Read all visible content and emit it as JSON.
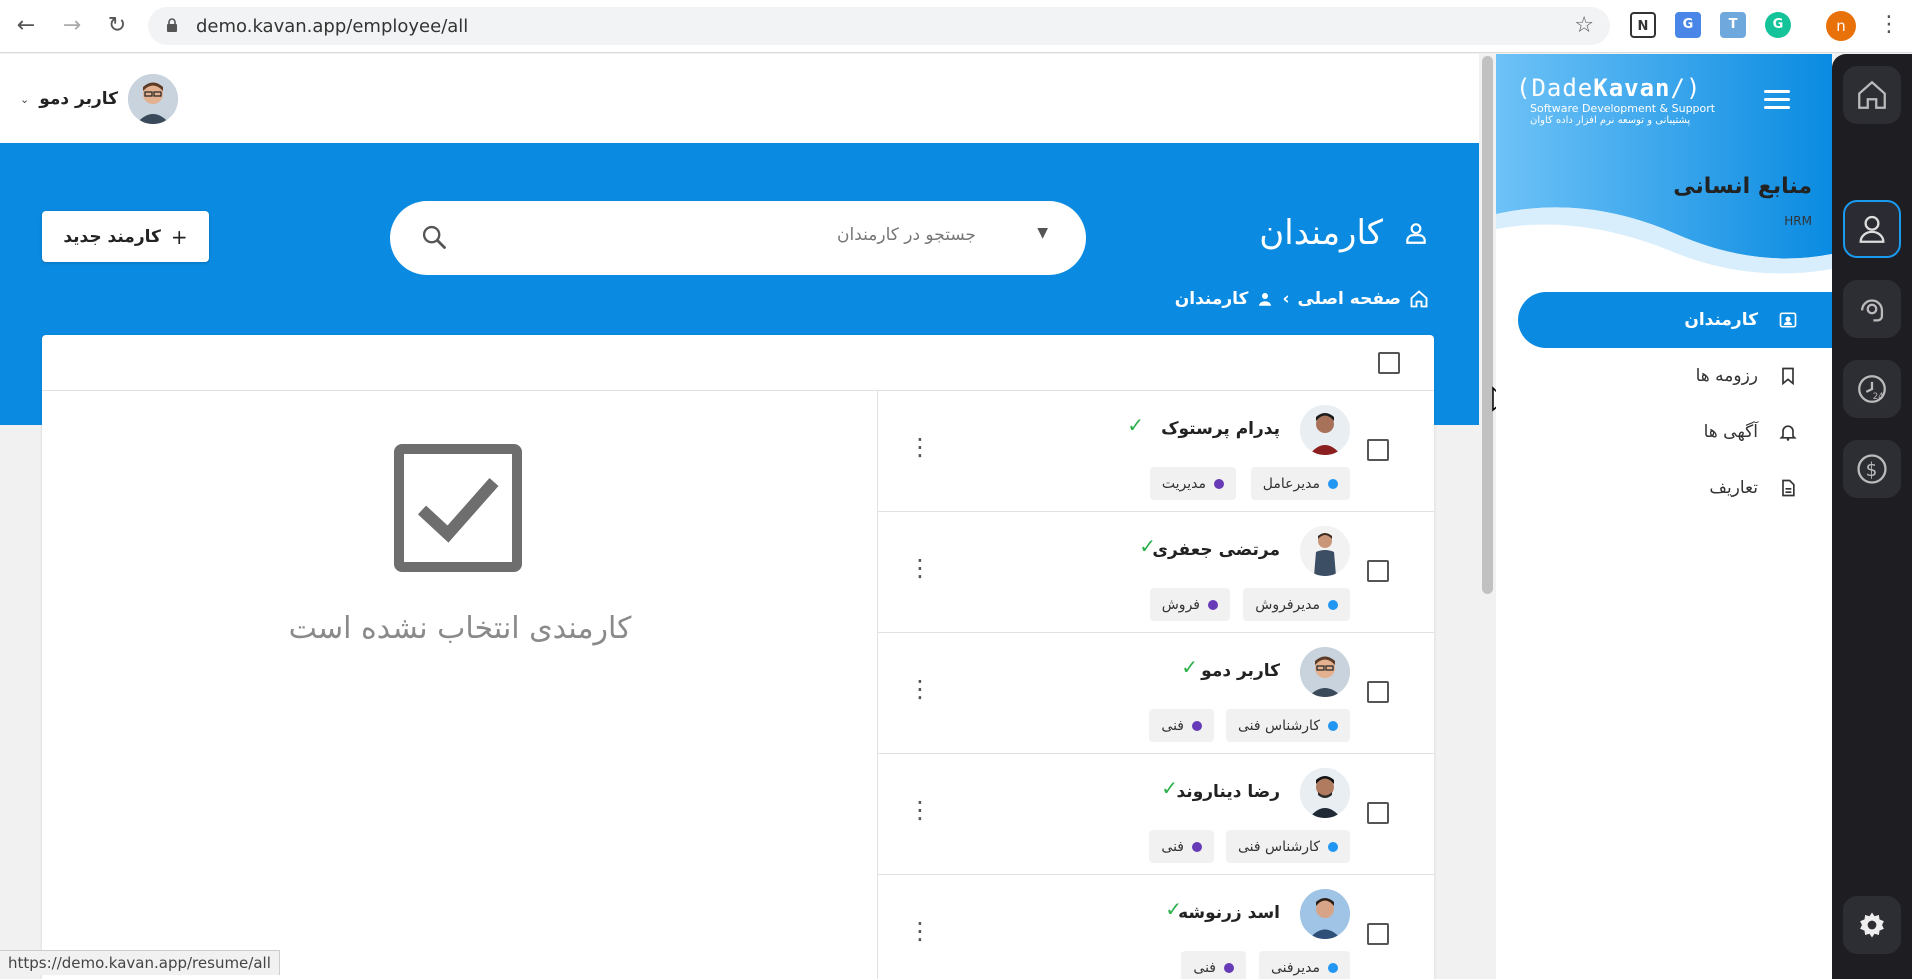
{
  "browser": {
    "url": "demo.kavan.app/employee/all",
    "profile_initial": "n",
    "status_url": "https://demo.kavan.app/resume/all"
  },
  "topbar": {
    "user_name": "کاربر دمو"
  },
  "header": {
    "title": "کارمندان",
    "search_placeholder": "جستجو در کارمندان",
    "new_button_label": "کارمند جدید",
    "breadcrumb": {
      "home": "صفحه اصلی",
      "current": "کارمندان"
    }
  },
  "detail": {
    "empty_text": "کارمندی انتخاب نشده است"
  },
  "employees": [
    {
      "name": "پدرام پرستوک",
      "position": "مدیرعامل",
      "department": "مدیریت"
    },
    {
      "name": "مرتضی جعفری",
      "position": "مدیرفروش",
      "department": "فروش"
    },
    {
      "name": "کاربر دمو",
      "position": "کارشناس فنی",
      "department": "فنی"
    },
    {
      "name": "رضا دیناروند",
      "position": "کارشناس فنی",
      "department": "فنی"
    },
    {
      "name": "اسد زرنوشه",
      "position": "مدیرفنی",
      "department": "فنی"
    }
  ],
  "sidebar": {
    "logo_prefix": "Dade",
    "logo_emphasis": "Kavan",
    "logo_tagline": "Software Development & Support",
    "logo_tagline_fa": "پشتیبانی و توسعه نرم افزار داده کاوان",
    "title": "منابع انسانی",
    "subtitle": "HRM",
    "items": [
      {
        "label": "کارمندان",
        "icon": "id-badge-icon"
      },
      {
        "label": "رزومه ها",
        "icon": "bookmark-icon"
      },
      {
        "label": "آگهی ها",
        "icon": "bell-icon"
      },
      {
        "label": "تعاریف",
        "icon": "document-icon"
      }
    ]
  },
  "rail": [
    "home-icon",
    "person-icon",
    "support-icon",
    "clock-24-icon",
    "dollar-icon",
    "gear-icon"
  ],
  "colors": {
    "primary": "#0a8be1",
    "rail": "#1d1d22",
    "position_dot": "#2196f3",
    "department_dot": "#673ab7",
    "verified": "#2bb04a"
  }
}
